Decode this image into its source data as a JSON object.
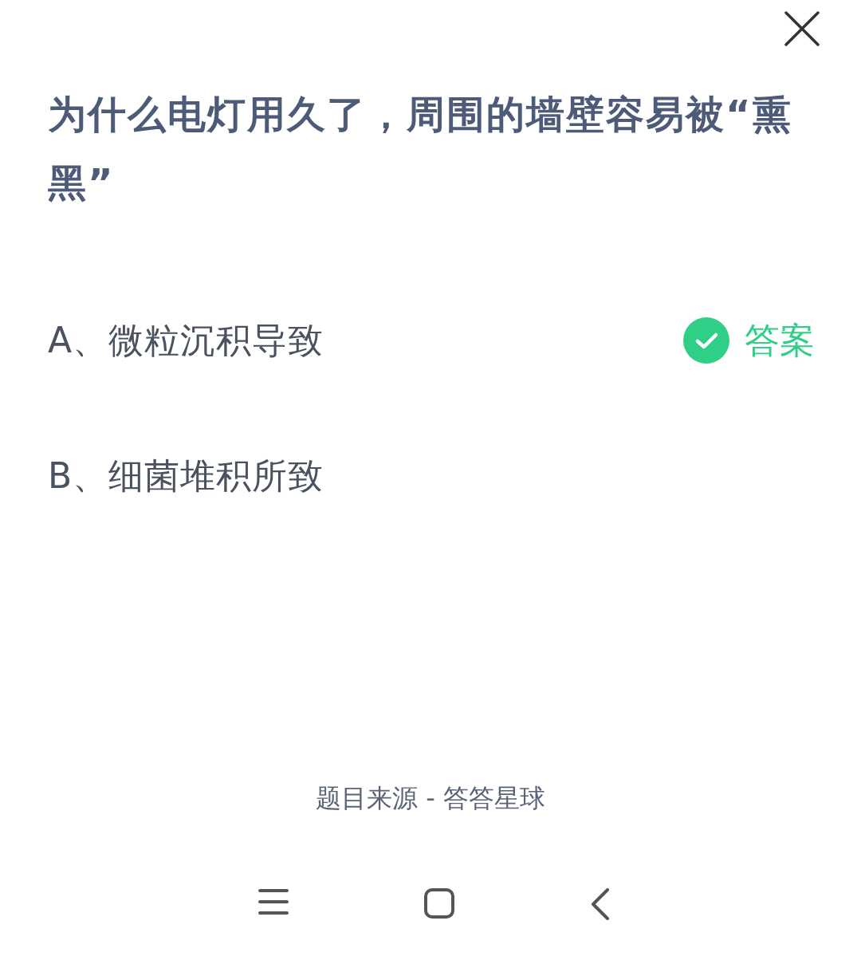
{
  "question": "为什么电灯用久了，周围的墙壁容易被“熏黑”",
  "options": [
    {
      "text": "A、微粒沉积导致",
      "correct": true,
      "answer_label": "答案"
    },
    {
      "text": "B、细菌堆积所致",
      "correct": false
    }
  ],
  "source": "题目来源 - 答答星球"
}
